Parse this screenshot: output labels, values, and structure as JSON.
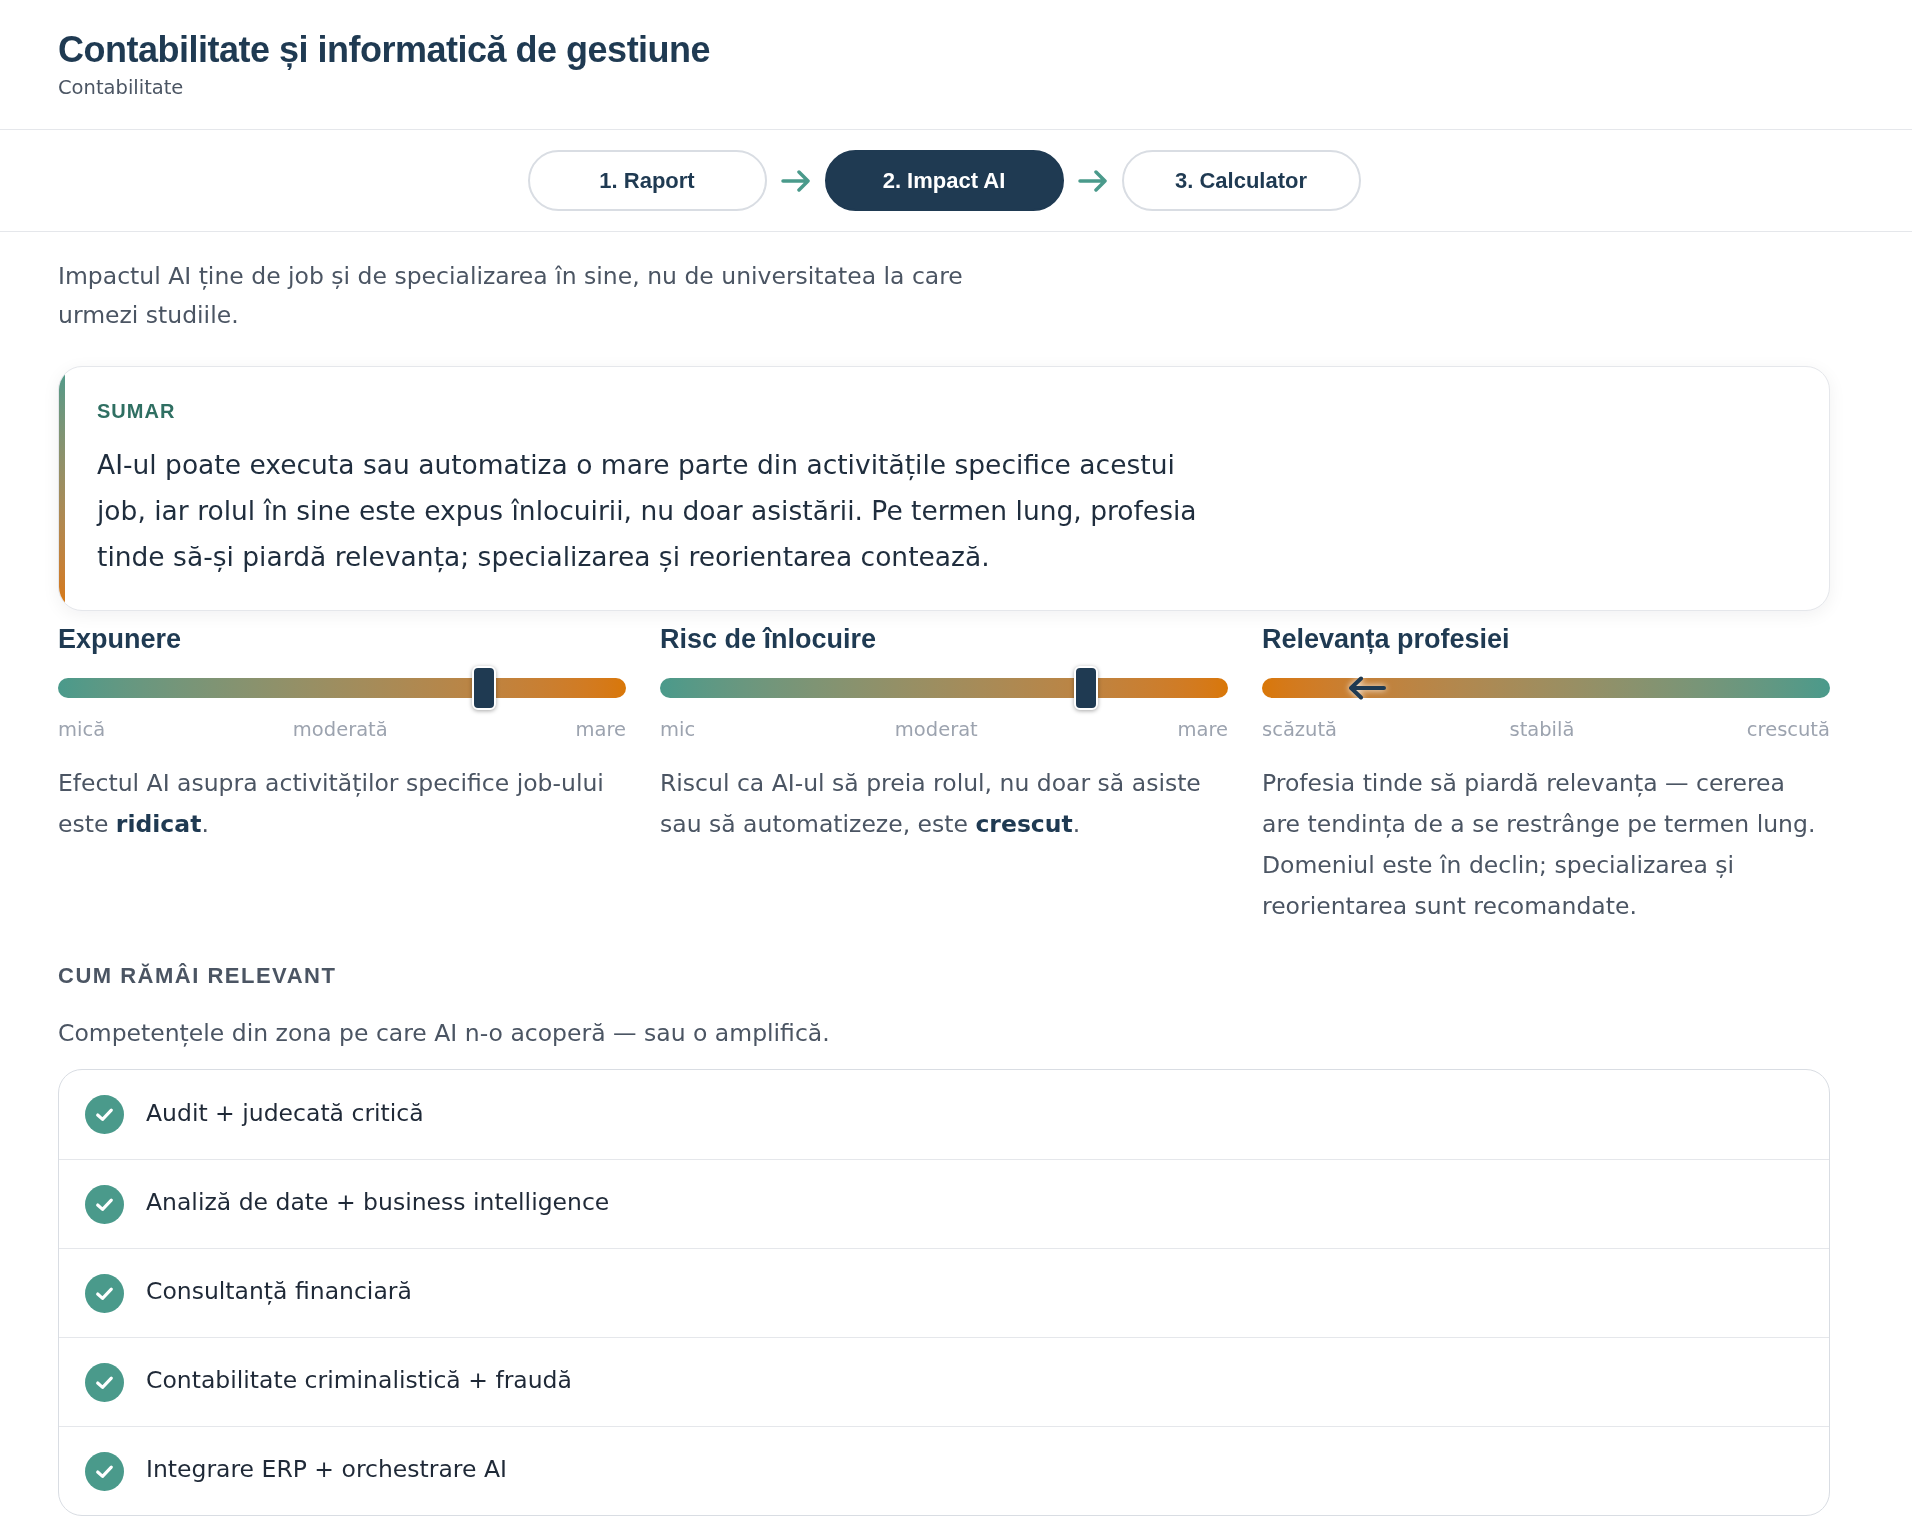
{
  "header": {
    "title": "Contabilitate și informatică de gestiune",
    "subtitle": "Contabilitate"
  },
  "steps": [
    {
      "label": "1. Raport",
      "selected": false
    },
    {
      "label": "2. Impact AI",
      "selected": true
    },
    {
      "label": "3. Calculator",
      "selected": false
    }
  ],
  "intro": "Impactul AI ține de job și de specializarea în sine, nu de universitatea la care urmezi studiile.",
  "summary": {
    "label": "SUMAR",
    "text": "AI-ul poate executa sau automatiza o mare parte din activitățile specifice acestui job, iar rolul în sine este expus înlocuirii, nu doar asistării. Pe termen lung, profesia tinde să-și piardă relevanța; specializarea și reorientarea contează."
  },
  "meters": [
    {
      "title": "Expunere",
      "kind": "thumb",
      "level": 0.75,
      "scale": [
        "mică",
        "moderată",
        "mare"
      ],
      "description": "Efectul AI asupra activităților specifice job-ului este **ridicat**."
    },
    {
      "title": "Risc de înlocuire",
      "kind": "thumb",
      "level": 0.75,
      "scale": [
        "mic",
        "moderat",
        "mare"
      ],
      "description": "Riscul ca AI-ul să preia rolul, nu doar să asiste sau să automatizeze, este **crescut**."
    },
    {
      "title": "Relevanța profesiei",
      "kind": "arrow",
      "level": 0.185,
      "scale": [
        "scăzută",
        "stabilă",
        "crescută"
      ],
      "description": "Profesia tinde să piardă relevanța — cererea are tendința de a se restrânge pe termen lung. Domeniul este în declin; specializarea și reorientarea sunt recomandate."
    }
  ],
  "skills": {
    "heading": "CUM RĂMÂI RELEVANT",
    "subtitle": "Competențele din zona pe care AI n-o acoperă — sau o amplifică.",
    "items": [
      "Audit + judecată critică",
      "Analiză de date + business intelligence",
      "Consultanță financiară",
      "Contabilitate criminalistică + fraudă",
      "Integrare ERP + orchestrare AI"
    ]
  }
}
